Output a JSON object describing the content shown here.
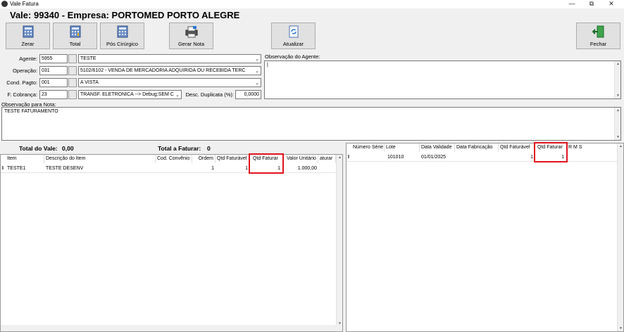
{
  "window": {
    "title": "Vale Fatura",
    "minimize_icon": "minimize-icon",
    "restore_icon": "restore-icon",
    "close_icon": "close-icon"
  },
  "heading": "Vale: 99340 - Empresa: PORTOMED PORTO ALEGRE",
  "toolbar": {
    "zerar": "Zerar",
    "total": "Total",
    "pos_cirurgico": "Pós Cirúrgico",
    "gerar_nota": "Gerar Nota",
    "atualizar": "Atualizar",
    "fechar": "Fechar"
  },
  "form": {
    "agente_label": "Agente:",
    "agente_code": "5955",
    "agente_name": "TESTE",
    "operacao_label": "Operação:",
    "operacao_code": "031",
    "operacao_name": "5102/6102 - VENDA DE MERCADORIA ADQUIRIDA OU RECEBIDA TERC",
    "cond_label": "Cond. Pagto:",
    "cond_code": "001",
    "cond_name": "A VISTA",
    "cobranca_label": "F. Cobrança:",
    "cobranca_code": "23",
    "cobranca_name": "TRANSF. ELETRONICA   --> Debug:SEM C",
    "desc_label": "Desc. Duplicata (%):",
    "desc_value": "0,0000",
    "obs_agente_label": "Observação do Agente:",
    "obs_agente_value": "|",
    "obs_nota_label": "Observação para Nota:",
    "obs_nota_value": "TESTE FATURAMENTO"
  },
  "totals": {
    "vale_label": "Total do Vale:",
    "vale_value": "0,00",
    "faturar_label": "Total a Faturar:",
    "faturar_value": "0"
  },
  "left_grid": {
    "columns": [
      "Item",
      "Descrição do Item",
      "Cod. Convênio",
      "Ordem",
      "Qtd Faturável",
      "Qtd Faturar",
      "Valor Unitário",
      "aturar"
    ],
    "rows": [
      {
        "marker": "I",
        "item": "TESTE1",
        "descricao": "TESTE DESENV",
        "convenio": "",
        "ordem": "1",
        "qtd_faturavel": "1",
        "qtd_faturar": "1",
        "valor": "1.000,00"
      }
    ]
  },
  "right_grid": {
    "columns": [
      "Número Série",
      "Lote",
      "Data Validade",
      "Data Fabricação",
      "Qtd Faturável",
      "Qtd Faturar",
      "R M S"
    ],
    "rows": [
      {
        "marker": "I",
        "serie": "",
        "lote": "101010",
        "validade": "01/01/2025",
        "fabricacao": "",
        "qtd_faturavel": "1",
        "qtd_faturar": "1"
      }
    ]
  },
  "colors": {
    "highlight": "#e0141e"
  }
}
